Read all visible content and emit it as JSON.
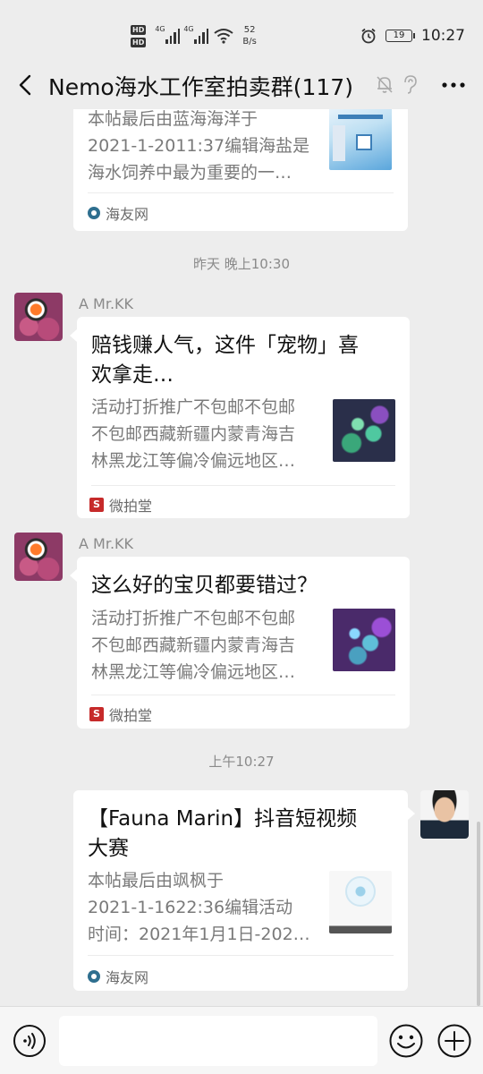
{
  "status_bar": {
    "hd1": "HD",
    "hd2": "HD",
    "net1": "4G",
    "net2": "4G",
    "speed_value": "52",
    "speed_unit": "B/s",
    "battery": "19",
    "time": "10:27"
  },
  "header": {
    "title": "Nemo海水工作室拍卖群(117)"
  },
  "messages": [
    {
      "desc": "本帖最后由蓝海海洋于2021-1-2011:37编辑海盐是海水饲养中最为重要的一…",
      "desc_lines": [
        "本帖最后由蓝海海洋于",
        "2021-1-2011:37编辑海盐是",
        "海水饲养中最为重要的一…"
      ],
      "source": "海友网"
    },
    {
      "time": "昨天 晚上10:30",
      "sender": "A  Mr.KK",
      "title_lines": [
        "赔钱赚人气，这件「宠物」喜",
        "欢拿走…"
      ],
      "desc_lines": [
        "活动打折推广不包邮不包邮",
        "不包邮西藏新疆内蒙青海吉",
        "林黑龙江等偏冷偏远地区…"
      ],
      "source": "微拍堂",
      "source_icon_char": "S"
    },
    {
      "sender": "A  Mr.KK",
      "title_lines": [
        "这么好的宝贝都要错过？"
      ],
      "desc_lines": [
        "活动打折推广不包邮不包邮",
        "不包邮西藏新疆内蒙青海吉",
        "林黑龙江等偏冷偏远地区…"
      ],
      "source": "微拍堂",
      "source_icon_char": "S"
    },
    {
      "time": "上午10:27",
      "title_lines": [
        "【Fauna Marin】抖音短视频",
        "大赛"
      ],
      "desc_lines": [
        "本帖最后由飒枫于",
        "2021-1-1622:36编辑活动",
        "时间：2021年1月1日-202…"
      ],
      "source": "海友网"
    }
  ],
  "input": {
    "value": "",
    "placeholder": ""
  },
  "icons": {
    "back": "back-arrow-icon",
    "mute": "mute-bell-icon",
    "ear": "ear-icon",
    "more": "more-dots-icon",
    "voice": "voice-icon",
    "emoji": "emoji-icon",
    "plus": "plus-icon",
    "alarm": "alarm-icon",
    "wifi": "wifi-icon"
  }
}
